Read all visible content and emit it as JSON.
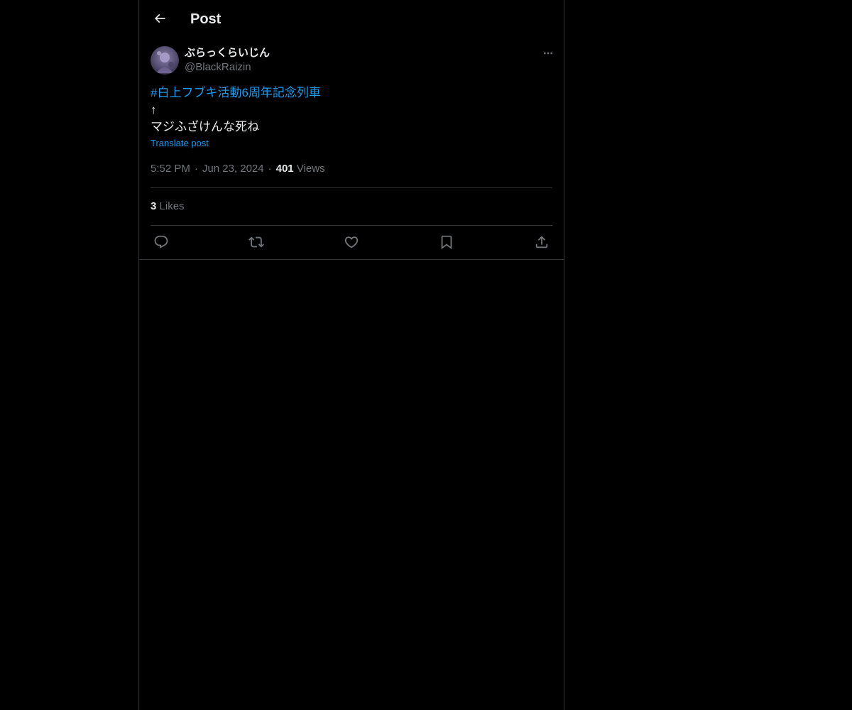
{
  "header": {
    "title": "Post",
    "back_icon": "arrow-left-icon"
  },
  "post": {
    "author": {
      "display_name": "ぶらっくらいじん",
      "handle": "@BlackRaizin"
    },
    "hashtag": "#白上フブキ活動6周年記念列車",
    "body_line_2": "↑",
    "body_line_3": "マジふざけんな死ね",
    "translate_label": "Translate post",
    "time": "5:52 PM",
    "date": "Jun 23, 2024",
    "views_count": "401",
    "views_label": "Views",
    "likes_count": "3",
    "likes_label": "Likes"
  },
  "actions": [
    {
      "icon": "reply-icon"
    },
    {
      "icon": "repost-icon"
    },
    {
      "icon": "like-icon"
    },
    {
      "icon": "bookmark-icon"
    },
    {
      "icon": "share-icon"
    }
  ],
  "colors": {
    "background": "#000000",
    "text": "#e7e9ea",
    "secondary": "#71767b",
    "accent": "#1d9bf0",
    "border": "#2f3336"
  }
}
